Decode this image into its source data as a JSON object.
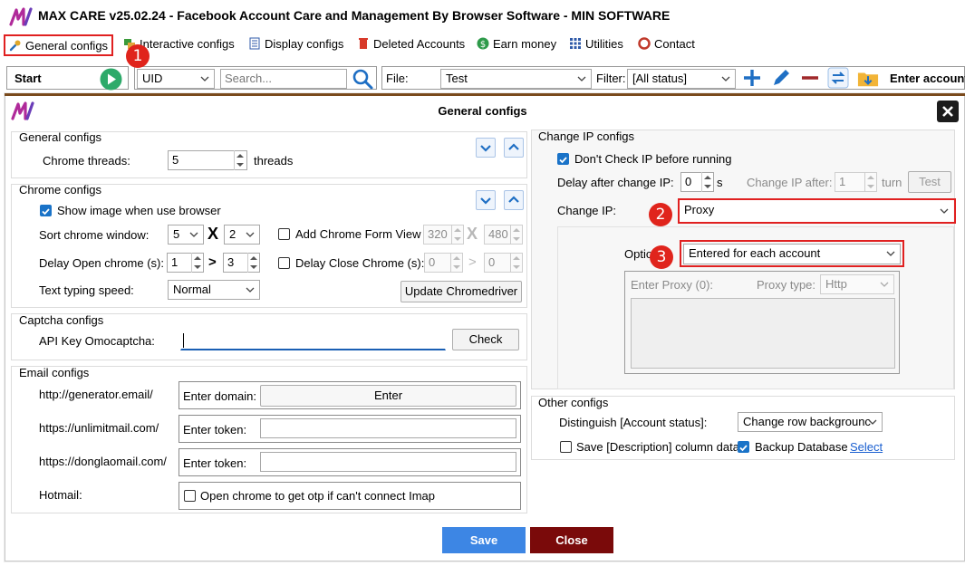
{
  "app": {
    "title": "MAX CARE v25.02.24 - Facebook Account Care and Management By Browser Software - MIN SOFTWARE"
  },
  "menu": [
    {
      "label": "General configs",
      "icon": "wrench-icon",
      "color": "#c08a1a"
    },
    {
      "label": "Interactive configs",
      "icon": "group-icon",
      "color": "#3a9a3a"
    },
    {
      "label": "Display configs",
      "icon": "list-icon",
      "color": "#2f5aa8"
    },
    {
      "label": "Deleted Accounts",
      "icon": "trash-icon",
      "color": "#d83a2a"
    },
    {
      "label": "Earn money",
      "icon": "dollar-icon",
      "color": "#2e9a4a"
    },
    {
      "label": "Utilities",
      "icon": "grid-icon",
      "color": "#2f5aa8"
    },
    {
      "label": "Contact",
      "icon": "lifebuoy-icon",
      "color": "#c0392b"
    }
  ],
  "toolbar": {
    "start_label": "Start",
    "search_field": "UID",
    "search_placeholder": "Search...",
    "file_label": "File:",
    "file_value": "Test",
    "filter_label": "Filter:",
    "filter_value": "[All status]",
    "enter_accounts_label": "Enter accounts"
  },
  "dialog": {
    "title": "General configs",
    "general": {
      "title": "General configs",
      "threads_label": "Chrome threads:",
      "threads_value": "5",
      "threads_unit": "threads"
    },
    "chrome": {
      "title": "Chrome configs",
      "show_image_label": "Show image when use browser",
      "show_image_checked": true,
      "sort_label": "Sort chrome window:",
      "sort_cols": "5",
      "sort_x": "X",
      "sort_rows": "2",
      "add_form_label": "Add Chrome Form View",
      "form_w": "320",
      "form_x": "X",
      "form_h": "480",
      "delay_open_label": "Delay Open chrome (s):",
      "delay_open_from": "1",
      "delay_open_gt": ">",
      "delay_open_to": "3",
      "delay_close_label": "Delay Close Chrome (s):",
      "delay_close_from": "0",
      "delay_close_gt": ">",
      "delay_close_to": "0",
      "typing_label": "Text typing speed:",
      "typing_value": "Normal",
      "update_driver_label": "Update Chromedriver"
    },
    "captcha": {
      "title": "Captcha configs",
      "api_label": "API Key Omocaptcha:",
      "api_value": "",
      "check_label": "Check"
    },
    "email": {
      "title": "Email configs",
      "row1_site": "http://generator.email/",
      "row1_label": "Enter domain:",
      "row1_button": "Enter",
      "row2_site": "https://unlimitmail.com/",
      "row2_label": "Enter token:",
      "row3_site": "https://donglaomail.com/",
      "row3_label": "Enter token:",
      "row4_site": "Hotmail:",
      "row4_label": "Open chrome to get otp if can't connect Imap"
    },
    "ip": {
      "title": "Change IP configs",
      "dont_check_label": "Don't Check IP before running",
      "dont_check_checked": true,
      "delay_label": "Delay after change IP:",
      "delay_value": "0",
      "delay_unit": "s",
      "change_after_label": "Change IP after:",
      "change_after_value": "1",
      "change_after_unit": "turn",
      "test_label": "Test",
      "change_ip_label": "Change IP:",
      "change_ip_value": "Proxy",
      "option_label": "Option",
      "option_value": "Entered for each account",
      "enter_proxy_label": "Enter Proxy (0):",
      "proxy_type_label": "Proxy type:",
      "proxy_type_value": "Http"
    },
    "other": {
      "title": "Other configs",
      "distinguish_label": "Distinguish [Account status]:",
      "distinguish_value": "Change row backgrounc",
      "save_desc_label": "Save [Description] column data",
      "save_desc_checked": false,
      "backup_label": "Backup Database",
      "backup_checked": true,
      "select_link": "Select"
    },
    "save_label": "Save",
    "close_label": "Close"
  },
  "badges": [
    "1",
    "2",
    "3"
  ],
  "colors": {
    "accent_blue": "#1a73c8",
    "save_blue": "#3d86e4",
    "close_maroon": "#7a0a0a",
    "highlight_red": "#e02020",
    "dialog_top": "#7a4a1c"
  }
}
